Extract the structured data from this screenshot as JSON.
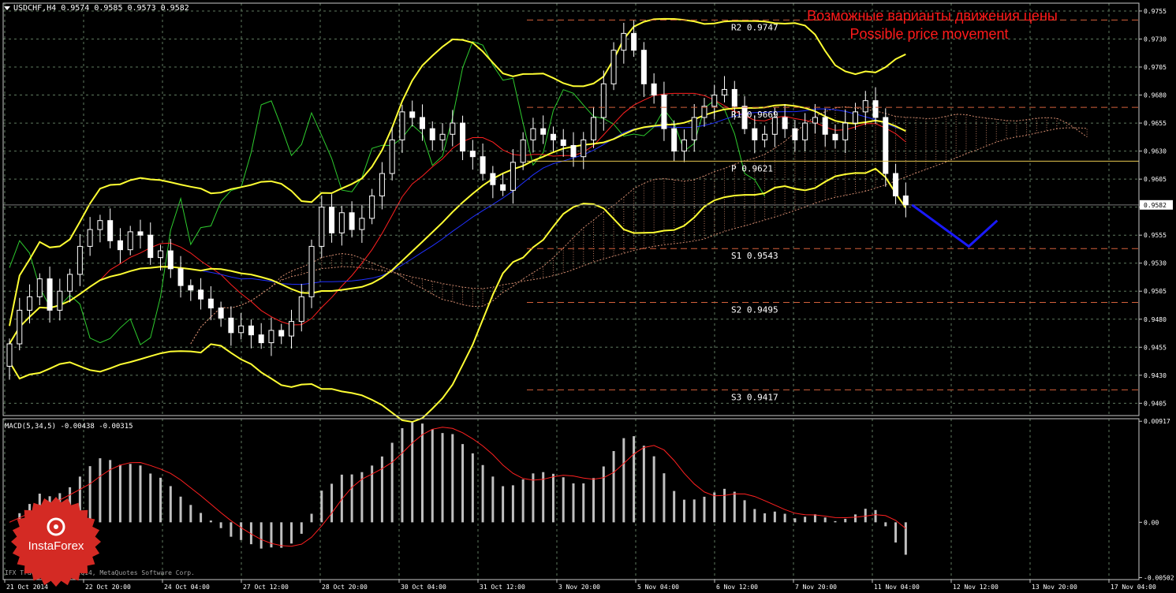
{
  "chart_data": {
    "type": "candlestick",
    "header": "USDCHF,H4  0.9574 0.9585 0.9573 0.9582",
    "symbol": "USDCHF,H4",
    "ohlc_readout": {
      "open": 0.9574,
      "high": 0.9585,
      "low": 0.9573,
      "close": 0.9582
    },
    "current_price_label": "0.9582",
    "annotation_ru": "Возможные варианты движения цены",
    "annotation_en": "Possible price movement",
    "ylim": [
      0.9394,
      0.9762
    ],
    "y_ticks": [
      "0.9755",
      "0.9730",
      "0.9705",
      "0.9680",
      "0.9655",
      "0.9630",
      "0.9605",
      "0.9580",
      "0.9555",
      "0.9530",
      "0.9505",
      "0.9480",
      "0.9455",
      "0.9430",
      "0.9405"
    ],
    "x_ticks": [
      "21 Oct 2014",
      "22 Oct 20:00",
      "24 Oct 04:00",
      "27 Oct 12:00",
      "28 Oct 20:00",
      "30 Oct 04:00",
      "31 Oct 12:00",
      "3 Nov 20:00",
      "5 Nov 04:00",
      "6 Nov 12:00",
      "7 Nov 20:00",
      "11 Nov 04:00",
      "12 Nov 12:00",
      "13 Nov 20:00",
      "17 Nov 04:00"
    ],
    "pivot_levels": [
      {
        "label": "R2",
        "value": "0.9747"
      },
      {
        "label": "R1",
        "value": "0.9669"
      },
      {
        "label": "P",
        "value": "0.9621"
      },
      {
        "label": "S1",
        "value": "0.9543"
      },
      {
        "label": "S2",
        "value": "0.9495"
      },
      {
        "label": "S3",
        "value": "0.9417"
      }
    ],
    "close": [
      0.9458,
      0.9488,
      0.95,
      0.9516,
      0.9488,
      0.9505,
      0.952,
      0.9545,
      0.956,
      0.9568,
      0.955,
      0.9542,
      0.9558,
      0.9555,
      0.9535,
      0.9541,
      0.9525,
      0.951,
      0.9506,
      0.9498,
      0.949,
      0.9481,
      0.9468,
      0.9474,
      0.9466,
      0.9459,
      0.947,
      0.9465,
      0.9478,
      0.95,
      0.9545,
      0.958,
      0.9557,
      0.9575,
      0.956,
      0.957,
      0.959,
      0.961,
      0.964,
      0.9665,
      0.966,
      0.965,
      0.964,
      0.9645,
      0.9655,
      0.963,
      0.9625,
      0.961,
      0.96,
      0.9595,
      0.962,
      0.964,
      0.965,
      0.9645,
      0.964,
      0.9635,
      0.9625,
      0.964,
      0.966,
      0.969,
      0.972,
      0.9735,
      0.972,
      0.969,
      0.968,
      0.965,
      0.963,
      0.964,
      0.966,
      0.967,
      0.968,
      0.9685,
      0.967,
      0.965,
      0.964,
      0.9645,
      0.966,
      0.965,
      0.964,
      0.9655,
      0.966,
      0.9645,
      0.964,
      0.9655,
      0.9665,
      0.9675,
      0.966,
      0.961,
      0.959,
      0.9582
    ],
    "high_low_spread": 0.0012,
    "bollinger_period": 20,
    "bollinger_sigma": 2,
    "moving_averages": [
      {
        "period": 10,
        "color": "#ff2020"
      },
      {
        "period": 24,
        "color": "#2030ff"
      }
    ],
    "forecast_path": [
      0.9582,
      0.9545,
      0.9568
    ],
    "macd": {
      "label": "MACD(5,34,5) -0.00438 -0.00315",
      "ylim": [
        -0.0052,
        0.0094
      ],
      "y_ticks": [
        "0.00917",
        "0.00",
        "-0.00502"
      ],
      "signal_period": 5
    },
    "colors": {
      "background": "#000000",
      "grid": "#5f7a5f",
      "axis": "#c8c8c8",
      "bollinger": "#ffff33",
      "chikou": "#2ecc2e",
      "cloud": "#d08a6e",
      "pivot": "#d4613b",
      "pivot_p": "#e8c850",
      "forecast": "#1a1aff",
      "macd_hist": "#c0c0c0",
      "macd_signal": "#ff2020",
      "annotation": "#ff1a1a"
    }
  },
  "footer": {
    "copyright": "IFX Trader, © 2001-2014, MetaQuotes Software Corp."
  },
  "logo": {
    "text": "InstaForex",
    "color": "#d42a24"
  },
  "icons": {
    "dropdown": "triangle-down-icon"
  }
}
